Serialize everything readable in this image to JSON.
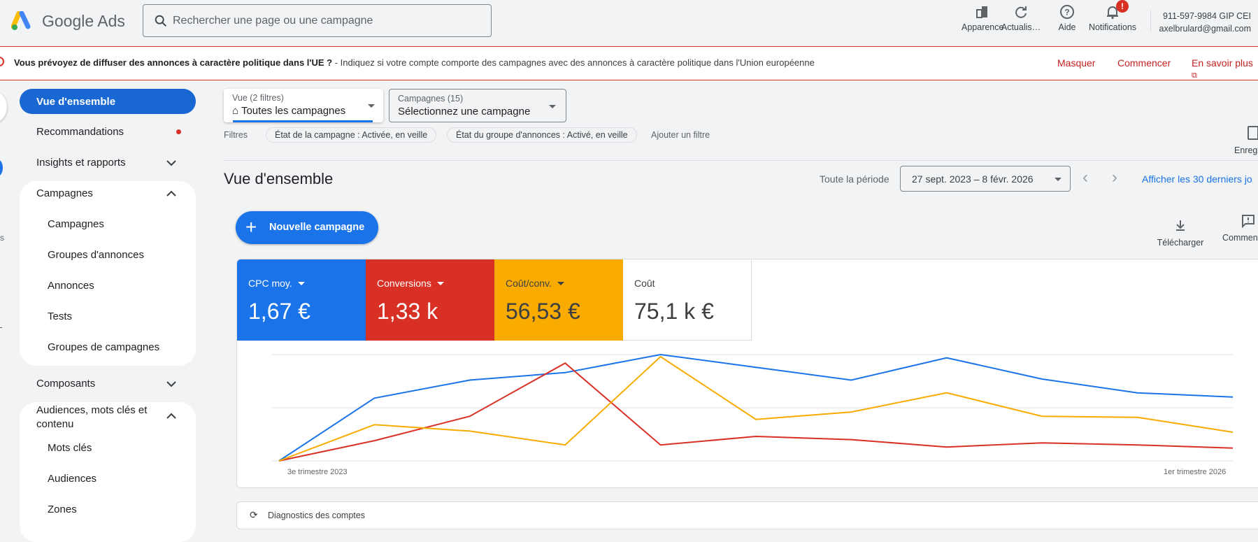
{
  "header": {
    "brand": "Google Ads",
    "search_placeholder": "Rechercher une page ou une campagne",
    "actions": [
      {
        "label": "Apparence",
        "icon": "appearance-icon"
      },
      {
        "label": "Actualis…",
        "icon": "refresh-icon"
      },
      {
        "label": "Aide",
        "icon": "help-icon"
      },
      {
        "label": "Notifications",
        "icon": "bell-icon"
      }
    ],
    "notification_badge": "!",
    "account_id": "911-597-9984 GIP CEI",
    "account_email": "axelbrulard@gmail.com"
  },
  "banner": {
    "title": "Vous prévoyez de diffuser des annonces à caractère politique dans l'UE ?",
    "text": " - Indiquez si votre compte comporte des campagnes avec des annonces à caractère politique dans l'Union européenne",
    "dismiss": "Masquer",
    "start": "Commencer",
    "learn_more": "En savoir plus"
  },
  "rail": {
    "partial_label": "s"
  },
  "sidebar": {
    "active": "Vue d'ensemble",
    "recommendations": "Recommandations",
    "insights": "Insights et rapports",
    "campaigns_group": {
      "label": "Campagnes",
      "items": [
        "Campagnes",
        "Groupes d'annonces",
        "Annonces",
        "Tests",
        "Groupes de campagnes"
      ]
    },
    "assets": "Composants",
    "audiences_group": {
      "label_line1": "Audiences, mots clés et",
      "label_line2": "contenu",
      "items": [
        "Mots clés",
        "Audiences",
        "Zones"
      ]
    }
  },
  "main": {
    "view_dropdown": {
      "label": "Vue (2 filtres)",
      "value": "Toutes les campagnes"
    },
    "campaign_dropdown": {
      "label": "Campagnes (15)",
      "value": "Sélectionnez une campagne"
    },
    "filters_label": "Filtres",
    "filters": [
      "État de la campagne : Activée, en veille",
      "État du groupe d'annonces : Activé, en veille"
    ],
    "add_filter": "Ajouter un filtre",
    "save_label": "Enreg",
    "title": "Vue d'ensemble",
    "period_label": "Toute la période",
    "date_range": "27 sept. 2023 – 8 févr. 2026",
    "last30": "Afficher les 30 derniers jo",
    "new_campaign": "Nouvelle campagne",
    "download": "Télécharger",
    "comment": "Commen",
    "metrics": [
      {
        "name": "CPC moy.",
        "value": "1,67 €",
        "color": "#1a73e8"
      },
      {
        "name": "Conversions",
        "value": "1,33 k",
        "color": "#d93025"
      },
      {
        "name": "Coût/conv.",
        "value": "56,53 €",
        "color": "#f9ab00"
      },
      {
        "name": "Coût",
        "value": "75,1 k €",
        "color": "#ffffff"
      }
    ],
    "diagnostics": "Diagnostics des comptes"
  },
  "chart_data": {
    "type": "line",
    "x_labels": [
      "3e trimestre 2023",
      "1er trimestre 2026"
    ],
    "ylim": [
      0,
      100
    ],
    "grid": true,
    "series": [
      {
        "name": "CPC moy.",
        "color": "#1a73e8",
        "values": [
          0,
          59,
          76,
          83,
          100,
          88,
          76,
          97,
          77,
          64,
          60
        ]
      },
      {
        "name": "Conversions",
        "color": "#d93025",
        "values": [
          0,
          19,
          42,
          92,
          15,
          23,
          20,
          13,
          17,
          15,
          12
        ]
      },
      {
        "name": "Coût/conv.",
        "color": "#f9ab00",
        "values": [
          0,
          34,
          28,
          15,
          98,
          39,
          46,
          64,
          42,
          41,
          27
        ]
      }
    ]
  }
}
